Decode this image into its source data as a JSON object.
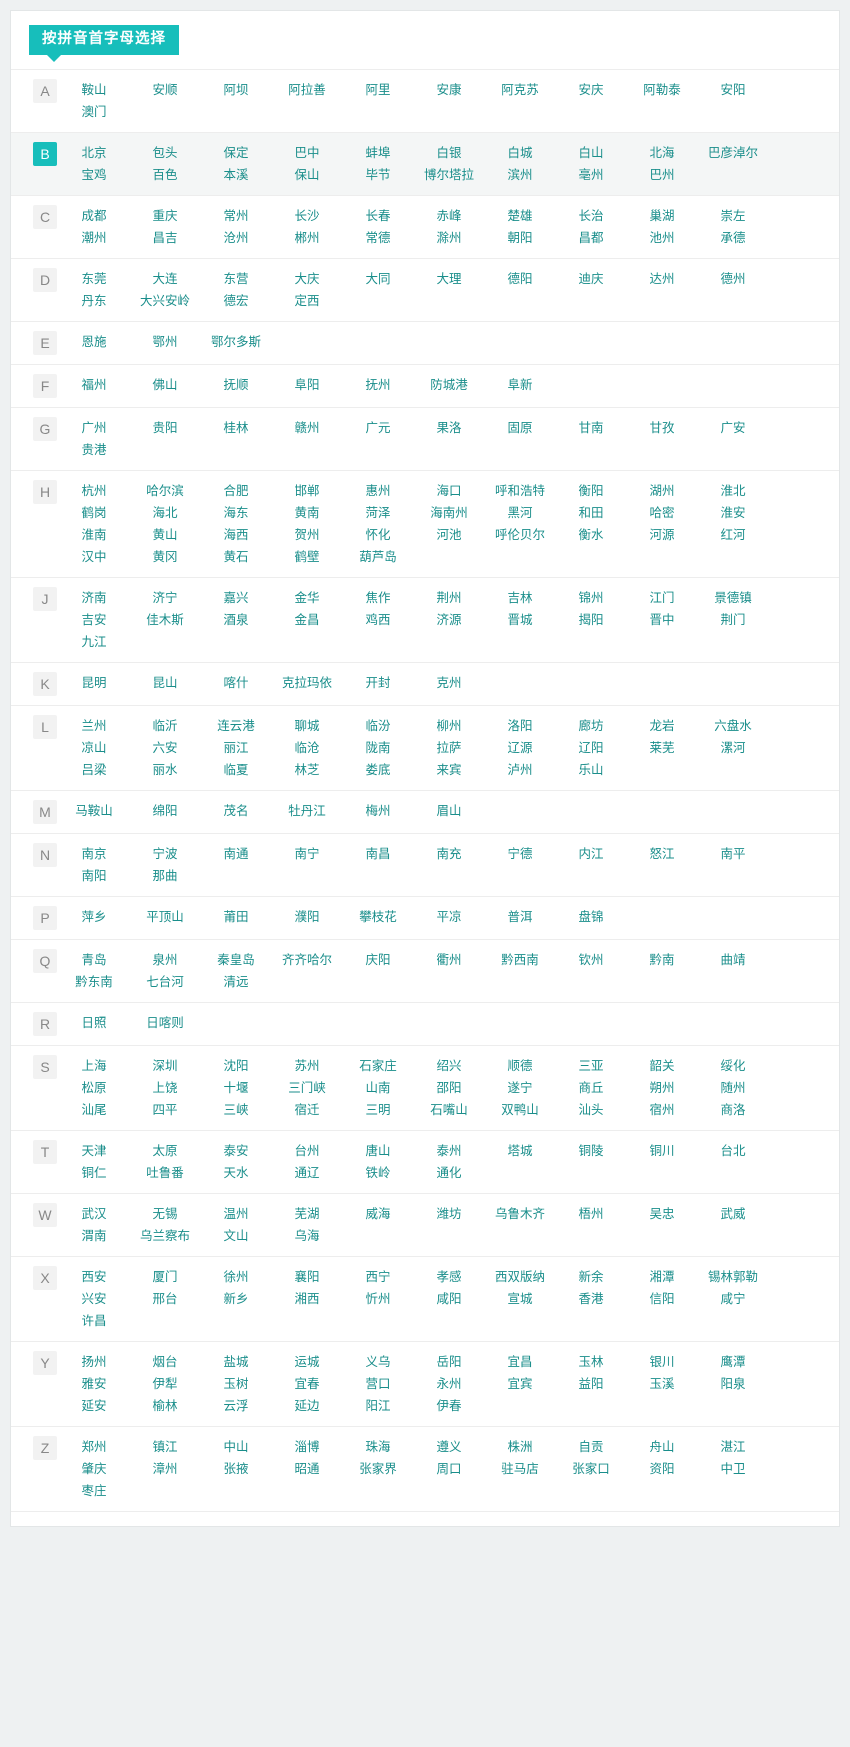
{
  "header": {
    "badge_label": "按拼音首字母选择"
  },
  "colors": {
    "accent": "#17bebb",
    "city_link": "#1a8e8b",
    "letter_chip_bg": "#f2f2f2",
    "letter_chip_text": "#888888",
    "active_row_bg": "#f4f6f6",
    "page_bg": "#eef1f2",
    "panel_bg": "#ffffff"
  },
  "groups": [
    {
      "letter": "A",
      "active": false,
      "cities": [
        "鞍山",
        "安顺",
        "阿坝",
        "阿拉善",
        "阿里",
        "安康",
        "阿克苏",
        "安庆",
        "阿勒泰",
        "安阳",
        "澳门"
      ]
    },
    {
      "letter": "B",
      "active": true,
      "cities": [
        "北京",
        "包头",
        "保定",
        "巴中",
        "蚌埠",
        "白银",
        "白城",
        "白山",
        "北海",
        "巴彦淖尔",
        "宝鸡",
        "百色",
        "本溪",
        "保山",
        "毕节",
        "博尔塔拉",
        "滨州",
        "亳州",
        "巴州"
      ]
    },
    {
      "letter": "C",
      "active": false,
      "cities": [
        "成都",
        "重庆",
        "常州",
        "长沙",
        "长春",
        "赤峰",
        "楚雄",
        "长治",
        "巢湖",
        "崇左",
        "潮州",
        "昌吉",
        "沧州",
        "郴州",
        "常德",
        "滁州",
        "朝阳",
        "昌都",
        "池州",
        "承德"
      ]
    },
    {
      "letter": "D",
      "active": false,
      "cities": [
        "东莞",
        "大连",
        "东营",
        "大庆",
        "大同",
        "大理",
        "德阳",
        "迪庆",
        "达州",
        "德州",
        "丹东",
        "大兴安岭",
        "德宏",
        "定西"
      ]
    },
    {
      "letter": "E",
      "active": false,
      "cities": [
        "恩施",
        "鄂州",
        "鄂尔多斯"
      ]
    },
    {
      "letter": "F",
      "active": false,
      "cities": [
        "福州",
        "佛山",
        "抚顺",
        "阜阳",
        "抚州",
        "防城港",
        "阜新"
      ]
    },
    {
      "letter": "G",
      "active": false,
      "cities": [
        "广州",
        "贵阳",
        "桂林",
        "赣州",
        "广元",
        "果洛",
        "固原",
        "甘南",
        "甘孜",
        "广安",
        "贵港"
      ]
    },
    {
      "letter": "H",
      "active": false,
      "cities": [
        "杭州",
        "哈尔滨",
        "合肥",
        "邯郸",
        "惠州",
        "海口",
        "呼和浩特",
        "衡阳",
        "湖州",
        "淮北",
        "鹤岗",
        "海北",
        "海东",
        "黄南",
        "菏泽",
        "海南州",
        "黑河",
        "和田",
        "哈密",
        "淮安",
        "淮南",
        "黄山",
        "海西",
        "贺州",
        "怀化",
        "河池",
        "呼伦贝尔",
        "衡水",
        "河源",
        "红河",
        "汉中",
        "黄冈",
        "黄石",
        "鹤壁",
        "葫芦岛"
      ]
    },
    {
      "letter": "J",
      "active": false,
      "cities": [
        "济南",
        "济宁",
        "嘉兴",
        "金华",
        "焦作",
        "荆州",
        "吉林",
        "锦州",
        "江门",
        "景德镇",
        "吉安",
        "佳木斯",
        "酒泉",
        "金昌",
        "鸡西",
        "济源",
        "晋城",
        "揭阳",
        "晋中",
        "荆门",
        "九江"
      ]
    },
    {
      "letter": "K",
      "active": false,
      "cities": [
        "昆明",
        "昆山",
        "喀什",
        "克拉玛依",
        "开封",
        "克州"
      ]
    },
    {
      "letter": "L",
      "active": false,
      "cities": [
        "兰州",
        "临沂",
        "连云港",
        "聊城",
        "临汾",
        "柳州",
        "洛阳",
        "廊坊",
        "龙岩",
        "六盘水",
        "凉山",
        "六安",
        "丽江",
        "临沧",
        "陇南",
        "拉萨",
        "辽源",
        "辽阳",
        "莱芜",
        "漯河",
        "吕梁",
        "丽水",
        "临夏",
        "林芝",
        "娄底",
        "来宾",
        "泸州",
        "乐山"
      ]
    },
    {
      "letter": "M",
      "active": false,
      "cities": [
        "马鞍山",
        "绵阳",
        "茂名",
        "牡丹江",
        "梅州",
        "眉山"
      ]
    },
    {
      "letter": "N",
      "active": false,
      "cities": [
        "南京",
        "宁波",
        "南通",
        "南宁",
        "南昌",
        "南充",
        "宁德",
        "内江",
        "怒江",
        "南平",
        "南阳",
        "那曲"
      ]
    },
    {
      "letter": "P",
      "active": false,
      "cities": [
        "萍乡",
        "平顶山",
        "莆田",
        "濮阳",
        "攀枝花",
        "平凉",
        "普洱",
        "盘锦"
      ]
    },
    {
      "letter": "Q",
      "active": false,
      "cities": [
        "青岛",
        "泉州",
        "秦皇岛",
        "齐齐哈尔",
        "庆阳",
        "衢州",
        "黔西南",
        "钦州",
        "黔南",
        "曲靖",
        "黔东南",
        "七台河",
        "清远"
      ]
    },
    {
      "letter": "R",
      "active": false,
      "cities": [
        "日照",
        "日喀则"
      ]
    },
    {
      "letter": "S",
      "active": false,
      "cities": [
        "上海",
        "深圳",
        "沈阳",
        "苏州",
        "石家庄",
        "绍兴",
        "顺德",
        "三亚",
        "韶关",
        "绥化",
        "松原",
        "上饶",
        "十堰",
        "三门峡",
        "山南",
        "邵阳",
        "遂宁",
        "商丘",
        "朔州",
        "随州",
        "汕尾",
        "四平",
        "三峡",
        "宿迁",
        "三明",
        "石嘴山",
        "双鸭山",
        "汕头",
        "宿州",
        "商洛"
      ]
    },
    {
      "letter": "T",
      "active": false,
      "cities": [
        "天津",
        "太原",
        "泰安",
        "台州",
        "唐山",
        "泰州",
        "塔城",
        "铜陵",
        "铜川",
        "台北",
        "铜仁",
        "吐鲁番",
        "天水",
        "通辽",
        "铁岭",
        "通化"
      ]
    },
    {
      "letter": "W",
      "active": false,
      "cities": [
        "武汉",
        "无锡",
        "温州",
        "芜湖",
        "威海",
        "潍坊",
        "乌鲁木齐",
        "梧州",
        "吴忠",
        "武威",
        "渭南",
        "乌兰察布",
        "文山",
        "乌海"
      ]
    },
    {
      "letter": "X",
      "active": false,
      "cities": [
        "西安",
        "厦门",
        "徐州",
        "襄阳",
        "西宁",
        "孝感",
        "西双版纳",
        "新余",
        "湘潭",
        "锡林郭勒",
        "兴安",
        "邢台",
        "新乡",
        "湘西",
        "忻州",
        "咸阳",
        "宣城",
        "香港",
        "信阳",
        "咸宁",
        "许昌"
      ]
    },
    {
      "letter": "Y",
      "active": false,
      "cities": [
        "扬州",
        "烟台",
        "盐城",
        "运城",
        "义乌",
        "岳阳",
        "宜昌",
        "玉林",
        "银川",
        "鹰潭",
        "雅安",
        "伊犁",
        "玉树",
        "宜春",
        "营口",
        "永州",
        "宜宾",
        "益阳",
        "玉溪",
        "阳泉",
        "延安",
        "榆林",
        "云浮",
        "延边",
        "阳江",
        "伊春"
      ]
    },
    {
      "letter": "Z",
      "active": false,
      "cities": [
        "郑州",
        "镇江",
        "中山",
        "淄博",
        "珠海",
        "遵义",
        "株洲",
        "自贡",
        "舟山",
        "湛江",
        "肇庆",
        "漳州",
        "张掖",
        "昭通",
        "张家界",
        "周口",
        "驻马店",
        "张家口",
        "资阳",
        "中卫",
        "枣庄"
      ]
    }
  ]
}
